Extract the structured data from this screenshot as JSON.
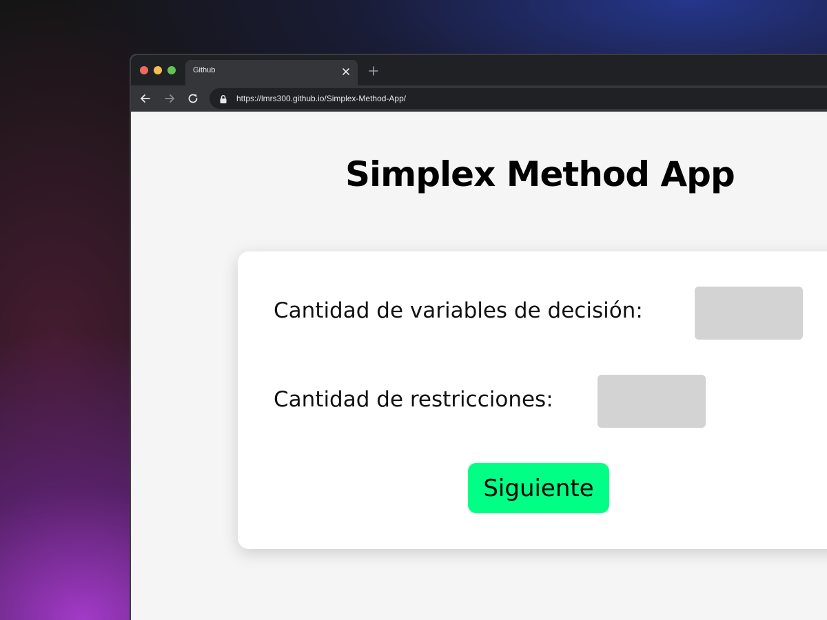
{
  "browser": {
    "tab_title": "Github",
    "url": "https://lmrs300.github.io/Simplex-Method-App/",
    "traffic_lights": {
      "close": "#ed6a5e",
      "minimize": "#f5bf4f",
      "maximize": "#61c554"
    },
    "icons": {
      "tab_close": "close-icon",
      "new_tab": "plus-icon",
      "back": "arrow-left-icon",
      "forward": "arrow-right-icon",
      "reload": "reload-icon",
      "lock": "lock-icon"
    }
  },
  "page": {
    "title": "Simplex Method App",
    "form": {
      "variables_label": "Cantidad de variables de decisión:",
      "variables_value": "",
      "constraints_label": "Cantidad de restricciones:",
      "constraints_value": "",
      "next_button_label": "Siguiente"
    }
  },
  "colors": {
    "accent_button": "#00ff85",
    "input_background": "#d3d3d3",
    "page_background": "#f5f5f5",
    "card_background": "#ffffff"
  }
}
